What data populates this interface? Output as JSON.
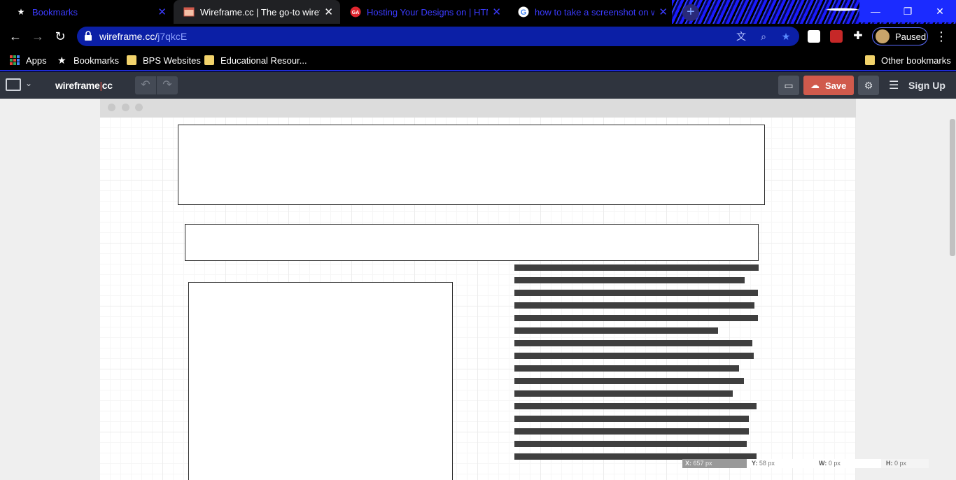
{
  "browser": {
    "tabs": [
      {
        "title": "Bookmarks",
        "icon": "star-icon",
        "active": false
      },
      {
        "title": "Wireframe.cc | The go-to wirefram",
        "icon": "wireframe-favicon",
        "active": true
      },
      {
        "title": "Hosting Your Designs on | HTML",
        "icon": "ga-favicon",
        "active": false
      },
      {
        "title": "how to take a screenshot on win",
        "icon": "google-favicon",
        "active": false
      }
    ],
    "url_host": "wireframe.cc/",
    "url_path": "j7qkcE",
    "profile_label": "Paused",
    "bookmarks": [
      {
        "label": "Apps",
        "icon": "apps-grid-icon"
      },
      {
        "label": "Bookmarks",
        "icon": "star-icon"
      },
      {
        "label": "BPS Websites",
        "icon": "folder-icon"
      },
      {
        "label": "Educational Resour...",
        "icon": "folder-icon"
      }
    ],
    "other_bookmarks": "Other bookmarks"
  },
  "app": {
    "logo_left": "wireframe",
    "logo_sep": "|",
    "logo_right": "cc",
    "save_label": "Save",
    "signup_label": "Sign Up",
    "accent": "#d05a4c"
  },
  "status": {
    "x_label": "X:",
    "x_value": "657 px",
    "y_label": "Y:",
    "y_value": "58 px",
    "w_label": "W:",
    "w_value": "0 px",
    "h_label": "H:",
    "h_value": "0 px"
  }
}
